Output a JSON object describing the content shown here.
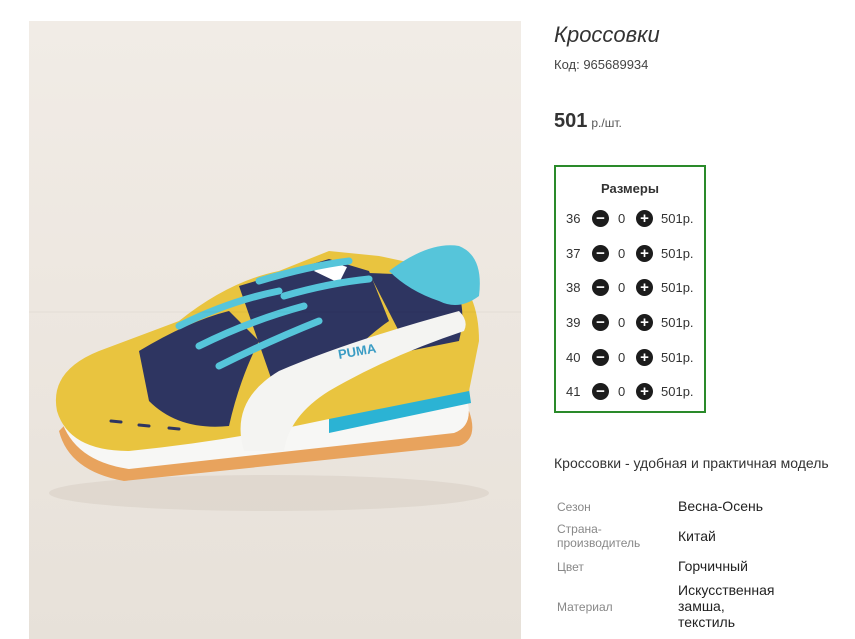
{
  "product": {
    "title": "Кроссовки",
    "code": "Код: 965689934",
    "price_value": "501",
    "price_unit": "р./шт.",
    "description": "Кроссовки - удобная и практичная модель"
  },
  "photo": {
    "brand_print": "PUMA"
  },
  "sizes": {
    "header": "Размеры",
    "rows": [
      {
        "size": "36",
        "qty": "0",
        "price": "501р."
      },
      {
        "size": "37",
        "qty": "0",
        "price": "501р."
      },
      {
        "size": "38",
        "qty": "0",
        "price": "501р."
      },
      {
        "size": "39",
        "qty": "0",
        "price": "501р."
      },
      {
        "size": "40",
        "qty": "0",
        "price": "501р."
      },
      {
        "size": "41",
        "qty": "0",
        "price": "501р."
      }
    ]
  },
  "attributes": [
    {
      "label": "Сезон",
      "value": "Весна-Осень"
    },
    {
      "label": "Страна-\nпроизводитель",
      "value": "Китай"
    },
    {
      "label": "Цвет",
      "value": "Горчичный"
    },
    {
      "label": "Материал",
      "value": "Искусственная\nзамша,\nтекстиль"
    }
  ],
  "colors": {
    "accent_border": "#2a8a2a",
    "buttons": "#1c1c1c"
  }
}
